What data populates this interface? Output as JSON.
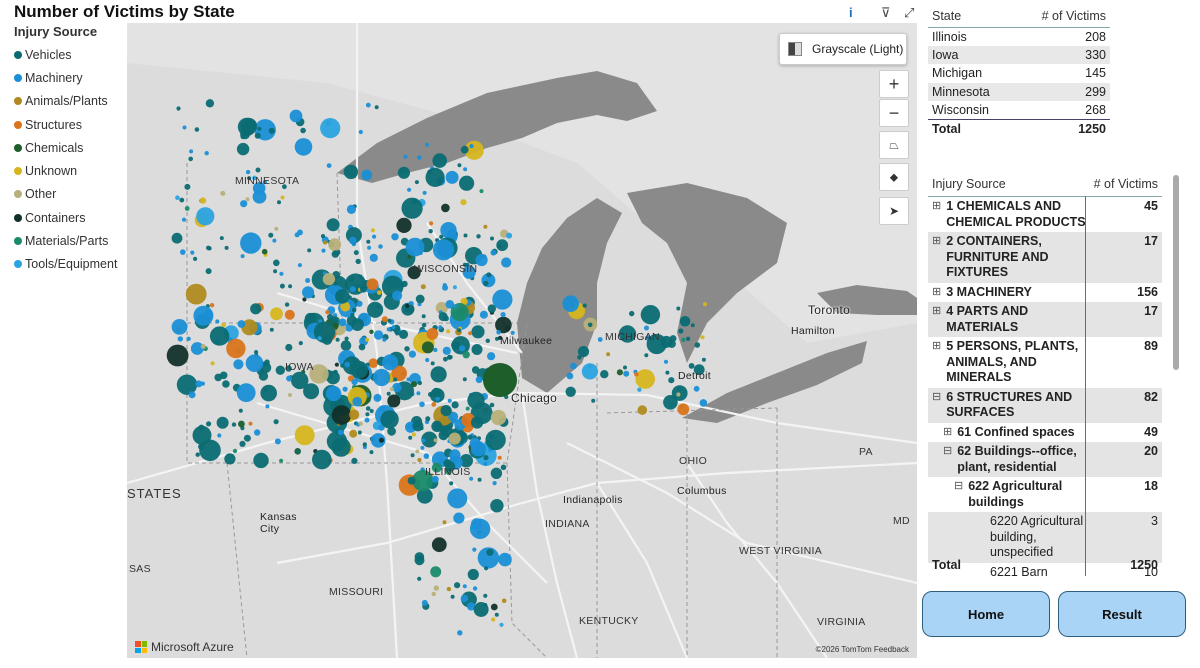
{
  "report": {
    "title": "Number of Victims by State"
  },
  "header_icons": [
    {
      "name": "info-icon",
      "glyph": "i"
    },
    {
      "name": "filter-icon",
      "glyph": "⊽"
    },
    {
      "name": "focus-mode-icon",
      "glyph": "⤢"
    }
  ],
  "legend": {
    "title": "Injury Source",
    "items": [
      {
        "label": "Vehicles",
        "color": "#0b6b73"
      },
      {
        "label": "Machinery",
        "color": "#1a8fd6"
      },
      {
        "label": "Animals/Plants",
        "color": "#b08a1f"
      },
      {
        "label": "Structures",
        "color": "#d9741a"
      },
      {
        "label": "Chemicals",
        "color": "#1d5e2a"
      },
      {
        "label": "Unknown",
        "color": "#d6b51f"
      },
      {
        "label": "Other",
        "color": "#b7b07a"
      },
      {
        "label": "Containers",
        "color": "#12302a"
      },
      {
        "label": "Materials/Parts",
        "color": "#1a8a6a"
      },
      {
        "label": "Tools/Equipment",
        "color": "#2aa3e0"
      }
    ]
  },
  "map": {
    "style_button": "Grayscale (Light)",
    "controls": {
      "zoom_in": "+",
      "zoom_out": "−",
      "tilt": "⏢",
      "compass": "⬥",
      "select": "➤"
    },
    "labels": {
      "minnesota": "MINNESOTA",
      "wisconsin": "WISCONSIN",
      "iowa": "IOWA",
      "illinois": "ILLINOIS",
      "michigan": "MICHIGAN",
      "ohio": "OHIO",
      "indiana": "INDIANA",
      "missouri": "MISSOURI",
      "kentucky": "KENTUCKY",
      "west_virginia": "WEST VIRGINIA",
      "virginia": "VIRGINIA",
      "pa": "PA",
      "md": "MD",
      "states": "STATES",
      "sas": "SAS",
      "chicago": "Chicago",
      "milwaukee": "Milwaukee",
      "detroit": "Detroit",
      "toronto": "Toronto",
      "hamilton": "Hamilton",
      "columbus": "Columbus",
      "indianapolis": "Indianapolis",
      "kansas_city": "Kansas\nCity"
    },
    "brand": "Microsoft Azure",
    "attribution": "©2026 TomTom  Feedback"
  },
  "state_table": {
    "headers": [
      "State",
      "# of Victims"
    ],
    "rows": [
      {
        "state": "Illinois",
        "value": "208"
      },
      {
        "state": "Iowa",
        "value": "330"
      },
      {
        "state": "Michigan",
        "value": "145"
      },
      {
        "state": "Minnesota",
        "value": "299"
      },
      {
        "state": "Wisconsin",
        "value": "268"
      }
    ],
    "total_label": "Total",
    "total_value": "1250"
  },
  "source_table": {
    "headers": [
      "Injury Source",
      "# of Victims"
    ],
    "rows": [
      {
        "exp": "⊞",
        "label": "1 CHEMICALS AND CHEMICAL PRODUCTS",
        "value": "45",
        "indent": 0
      },
      {
        "exp": "⊞",
        "label": "2 CONTAINERS, FURNITURE AND FIXTURES",
        "value": "17",
        "indent": 0
      },
      {
        "exp": "⊞",
        "label": "3 MACHINERY",
        "value": "156",
        "indent": 0
      },
      {
        "exp": "⊞",
        "label": "4 PARTS AND MATERIALS",
        "value": "17",
        "indent": 0
      },
      {
        "exp": "⊞",
        "label": "5 PERSONS, PLANTS, ANIMALS, AND MINERALS",
        "value": "89",
        "indent": 0
      },
      {
        "exp": "⊟",
        "label": "6 STRUCTURES AND SURFACES",
        "value": "82",
        "indent": 0
      },
      {
        "exp": "⊞",
        "label": "61 Confined spaces",
        "value": "49",
        "indent": 1
      },
      {
        "exp": "⊟",
        "label": "62 Buildings--office, plant, residential",
        "value": "20",
        "indent": 1
      },
      {
        "exp": "⊟",
        "label": "622 Agricultural buildings",
        "value": "18",
        "indent": 2
      },
      {
        "exp": "",
        "label": "6220 Agricultural building, unspecified",
        "value": "3",
        "indent": 3
      },
      {
        "exp": "",
        "label": "6221 Barn",
        "value": "10",
        "indent": 3
      }
    ],
    "total_label": "Total",
    "total_value": "1250"
  },
  "buttons": {
    "home": "Home",
    "result": "Result"
  }
}
